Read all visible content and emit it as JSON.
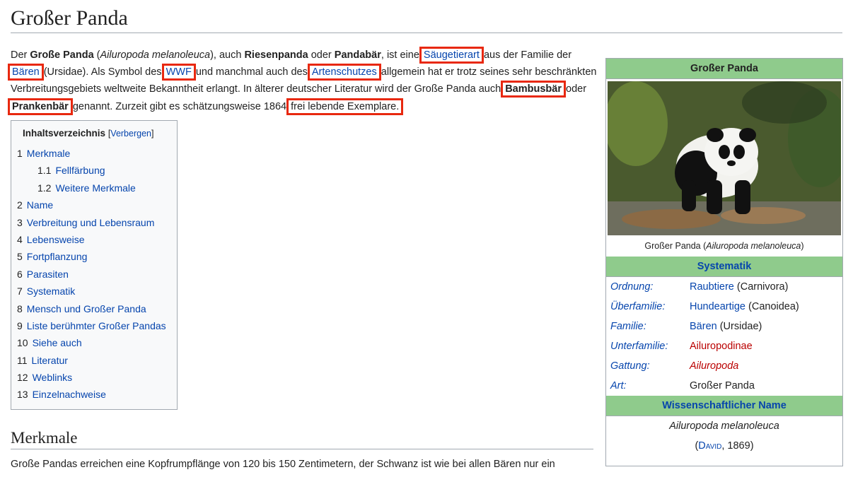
{
  "page": {
    "title": "Großer Panda"
  },
  "intro": {
    "t1": "Der ",
    "b1": "Große Panda",
    "t2": " (",
    "i1": "Ailuropoda melanoleuca",
    "t3": "), auch ",
    "b2": "Riesenpanda",
    "t4": " oder ",
    "b3": "Pandabär",
    "t5": ", ist eine ",
    "link_saeugetierart": "Säugetierart",
    "t6": " aus der Familie der ",
    "link_baeren": "Bären",
    "t7": " (Ursidae). Als Symbol des ",
    "link_wwf": "WWF",
    "t8": " und manchmal auch des ",
    "link_artenschutz": "Artenschutzes",
    "t9": " allgemein hat er trotz seines sehr beschränkten Verbreitungsgebiets weltweite Bekanntheit erlangt. In älterer deutscher Literatur wird der Große Panda auch ",
    "b4": "Bambusbär",
    "t10": " oder ",
    "b5": "Prankenbär",
    "t11": " genannt. Zurzeit gibt es schätzungsweise 1864 ",
    "hl_text": "frei lebende Exemplare.",
    "t12": ""
  },
  "toc": {
    "title": "Inhaltsverzeichnis",
    "toggle_open": "[",
    "toggle_label": "Verbergen",
    "toggle_close": "]",
    "items": [
      {
        "num": "1",
        "label": "Merkmale"
      },
      {
        "num": "1.1",
        "label": "Fellfärbung"
      },
      {
        "num": "1.2",
        "label": "Weitere Merkmale"
      },
      {
        "num": "2",
        "label": "Name"
      },
      {
        "num": "3",
        "label": "Verbreitung und Lebensraum"
      },
      {
        "num": "4",
        "label": "Lebensweise"
      },
      {
        "num": "5",
        "label": "Fortpflanzung"
      },
      {
        "num": "6",
        "label": "Parasiten"
      },
      {
        "num": "7",
        "label": "Systematik"
      },
      {
        "num": "8",
        "label": "Mensch und Großer Panda"
      },
      {
        "num": "9",
        "label": "Liste berühmter Großer Pandas"
      },
      {
        "num": "10",
        "label": "Siehe auch"
      },
      {
        "num": "11",
        "label": "Literatur"
      },
      {
        "num": "12",
        "label": "Weblinks"
      },
      {
        "num": "13",
        "label": "Einzelnachweise"
      }
    ]
  },
  "section": {
    "heading": "Merkmale",
    "text": "Große Pandas erreichen eine Kopfrumpflänge von 120 bis 150 Zentimetern, der Schwanz ist wie bei allen Bären nur ein"
  },
  "infobox": {
    "title": "Großer Panda",
    "caption_text": "Großer Panda (",
    "caption_italic": "Ailuropoda melanoleuca",
    "caption_close": ")",
    "systematik_heading": "Systematik",
    "rows": [
      {
        "label": "Ordnung:",
        "link": "Raubtiere",
        "extra": " (Carnivora)"
      },
      {
        "label": "Überfamilie:",
        "link": "Hundeartige",
        "extra": " (Canoidea)"
      },
      {
        "label": "Familie:",
        "link": "Bären",
        "extra": " (Ursidae)"
      },
      {
        "label": "Unterfamilie:",
        "link": "Ailuropodinae",
        "extra": ""
      },
      {
        "label": "Gattung:",
        "link": "Ailuropoda",
        "extra": ""
      },
      {
        "label": "Art:",
        "link": "",
        "extra": "Großer Panda"
      }
    ],
    "sciname_heading": "Wissenschaftlicher Name",
    "sciname": "Ailuropoda melanoleuca",
    "author_open": "(",
    "author_link": "David",
    "author_year": ", 1869)"
  },
  "colors": {
    "link": "#0645ad",
    "redlink": "#ba0000",
    "highlight": "#e8280f",
    "infobox_header": "#8fcb8c"
  }
}
